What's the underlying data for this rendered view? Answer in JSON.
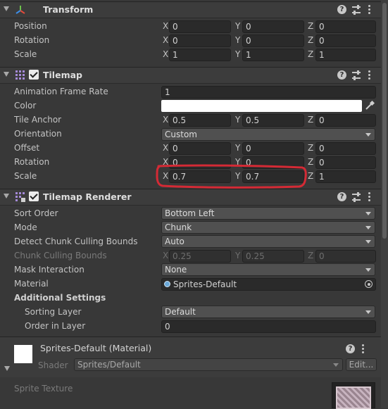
{
  "transform": {
    "title": "Transform",
    "rows": [
      {
        "label": "Position",
        "x": "0",
        "y": "0",
        "z": "0"
      },
      {
        "label": "Rotation",
        "x": "0",
        "y": "0",
        "z": "0"
      },
      {
        "label": "Scale",
        "x": "1",
        "y": "1",
        "z": "1"
      }
    ]
  },
  "tilemap": {
    "title": "Tilemap",
    "animation_frame_rate": {
      "label": "Animation Frame Rate",
      "value": "1"
    },
    "color": {
      "label": "Color",
      "value": "#ffffff"
    },
    "tile_anchor": {
      "label": "Tile Anchor",
      "x": "0.5",
      "y": "0.5",
      "z": "0"
    },
    "orientation": {
      "label": "Orientation",
      "value": "Custom"
    },
    "offset": {
      "label": "Offset",
      "x": "0",
      "y": "0",
      "z": "0"
    },
    "rotation": {
      "label": "Rotation",
      "x": "0",
      "y": "0",
      "z": "0"
    },
    "scale": {
      "label": "Scale",
      "x": "0.7",
      "y": "0.7",
      "z": "1"
    }
  },
  "renderer": {
    "title": "Tilemap Renderer",
    "sort_order": {
      "label": "Sort Order",
      "value": "Bottom Left"
    },
    "mode": {
      "label": "Mode",
      "value": "Chunk"
    },
    "detect_bounds": {
      "label": "Detect Chunk Culling Bounds",
      "value": "Auto"
    },
    "chunk_bounds": {
      "label": "Chunk Culling Bounds",
      "x": "0.25",
      "y": "0.25",
      "z": "0"
    },
    "mask_interaction": {
      "label": "Mask Interaction",
      "value": "None"
    },
    "material": {
      "label": "Material",
      "value": "Sprites-Default"
    },
    "additional": {
      "label": "Additional Settings"
    },
    "sorting_layer": {
      "label": "Sorting Layer",
      "value": "Default"
    },
    "order_in_layer": {
      "label": "Order in Layer",
      "value": "0"
    }
  },
  "material_panel": {
    "title": "Sprites-Default (Material)",
    "shader_label": "Shader",
    "shader_value": "Sprites/Default",
    "edit_label": "Edit...",
    "sprite_texture_label": "Sprite Texture"
  },
  "axes": {
    "x": "X",
    "y": "Y",
    "z": "Z"
  },
  "icons": {
    "help": "?",
    "annotation_color": "#d42a35"
  }
}
